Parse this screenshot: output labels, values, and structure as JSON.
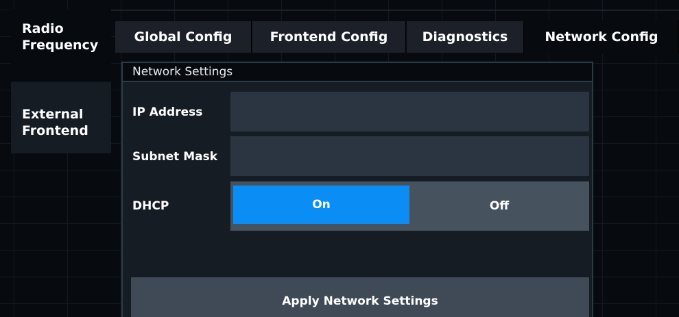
{
  "sidebar": {
    "items": [
      {
        "label": "Radio\nFrequency",
        "active": true
      },
      {
        "label": "External\nFrontend",
        "active": false
      }
    ]
  },
  "tabs": [
    {
      "label": "Global Config",
      "active": false
    },
    {
      "label": "Frontend Config",
      "active": false
    },
    {
      "label": "Diagnostics",
      "active": false
    },
    {
      "label": "Network Config",
      "active": true
    }
  ],
  "panel": {
    "title": "Network Settings",
    "fields": {
      "ip_address": {
        "label": "IP Address",
        "value": ""
      },
      "subnet_mask": {
        "label": "Subnet Mask",
        "value": ""
      }
    },
    "dhcp": {
      "label": "DHCP",
      "on_label": "On",
      "off_label": "Off",
      "selected": "On"
    },
    "apply_label": "Apply Network Settings"
  },
  "colors": {
    "accent": "#0a8ef5",
    "background": "#070b10",
    "panel": "#161c23",
    "input": "#2b3541"
  }
}
